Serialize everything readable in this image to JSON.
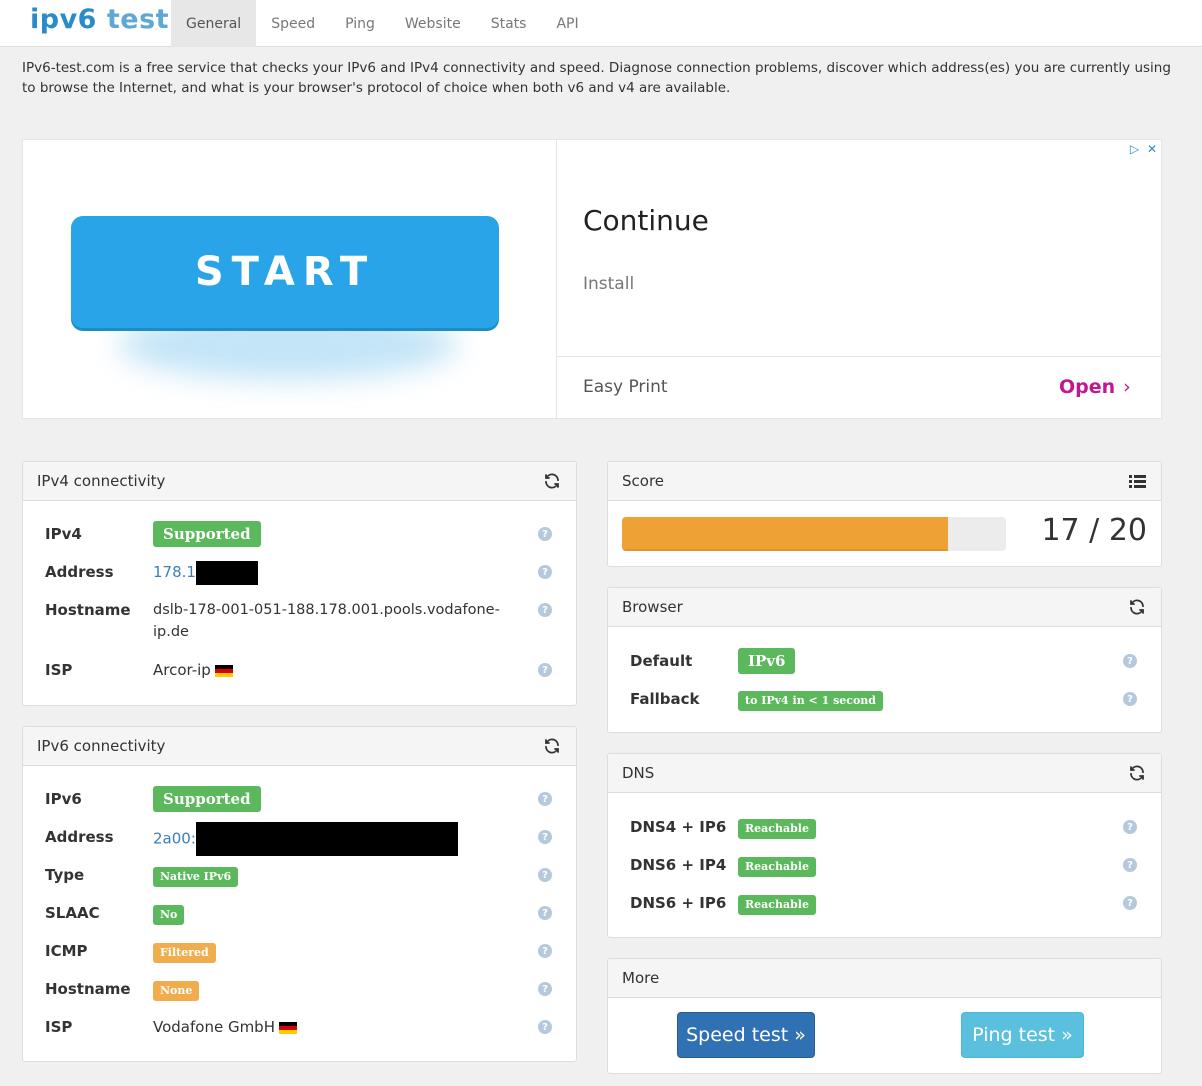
{
  "header": {
    "brand_part1": "ipv6",
    "brand_part2": " test",
    "nav": [
      "General",
      "Speed",
      "Ping",
      "Website",
      "Stats",
      "API"
    ],
    "active_tab": "General"
  },
  "intro": "IPv6-test.com is a free service that checks your IPv6 and IPv4 connectivity and speed. Diagnose connection problems, discover which address(es) you are currently using to browse the Internet, and what is your browser's protocol of choice when both v6 and v4 are available.",
  "ad": {
    "button_label": "START",
    "title": "Continue",
    "subtitle": "Install",
    "footer_label": "Easy Print",
    "open_label": "Open",
    "icons": [
      "ad-choices-icon",
      "close-icon"
    ]
  },
  "ipv4": {
    "title": "IPv4 connectivity",
    "rows": {
      "ipv4_label": "IPv4",
      "ipv4_value": "Supported",
      "address_label": "Address",
      "address_value": "178.1",
      "hostname_label": "Hostname",
      "hostname_value_line1": "dslb-178-001-051-188.178.001.pools.vodafone-",
      "hostname_value_line2": "ip.de",
      "isp_label": "ISP",
      "isp_value": "Arcor-ip"
    }
  },
  "ipv6": {
    "title": "IPv6 connectivity",
    "rows": {
      "ipv6_label": "IPv6",
      "ipv6_value": "Supported",
      "address_label": "Address",
      "address_value": "2a00:",
      "type_label": "Type",
      "type_value": "Native IPv6",
      "slaac_label": "SLAAC",
      "slaac_value": "No",
      "icmp_label": "ICMP",
      "icmp_value": "Filtered",
      "hostname_label": "Hostname",
      "hostname_value": "None",
      "isp_label": "ISP",
      "isp_value": "Vodafone GmbH"
    }
  },
  "score": {
    "title": "Score",
    "text": "17 / 20",
    "value": 17,
    "max": 20
  },
  "browser": {
    "title": "Browser",
    "default_label": "Default",
    "default_value": "IPv6",
    "fallback_label": "Fallback",
    "fallback_value": "to IPv4 in < 1 second"
  },
  "dns": {
    "title": "DNS",
    "rows": [
      {
        "label": "DNS4 + IP6",
        "value": "Reachable"
      },
      {
        "label": "DNS6 + IP4",
        "value": "Reachable"
      },
      {
        "label": "DNS6 + IP6",
        "value": "Reachable"
      }
    ]
  },
  "more": {
    "title": "More",
    "speed_button": "Speed test »",
    "ping_button": "Ping test »"
  },
  "colors": {
    "brand": "#2a8bc9",
    "success": "#5cb85c",
    "warning": "#f0ad4e",
    "primary": "#3071b4",
    "info": "#5bc0de",
    "ad_accent": "#c2188f"
  }
}
